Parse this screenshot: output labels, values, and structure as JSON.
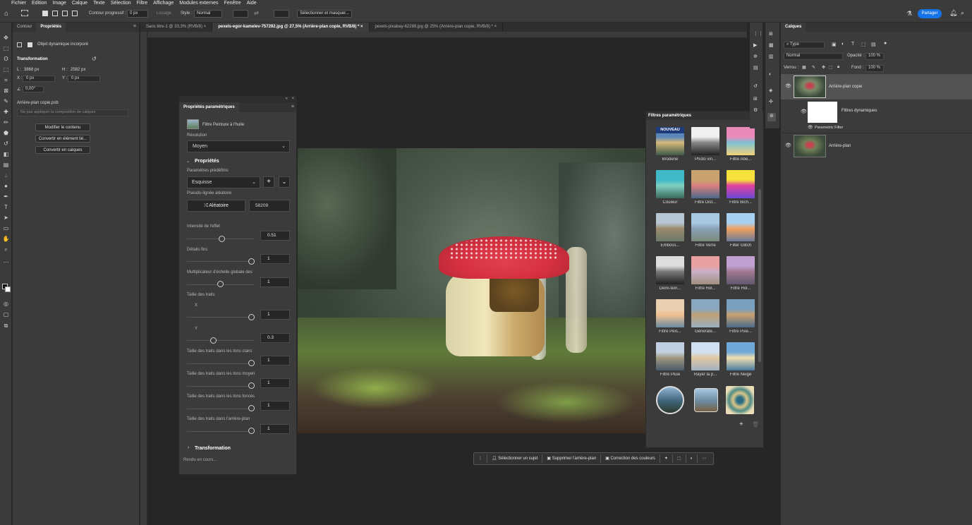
{
  "menu": [
    "Fichier",
    "Edition",
    "Image",
    "Calque",
    "Texte",
    "Sélection",
    "Filtre",
    "Affichage",
    "Modules externes",
    "Fenêtre",
    "Aide"
  ],
  "options": {
    "contour_label": "Contour progressif :",
    "contour_value": "0 px",
    "lissage_label": "Lissage",
    "style_label": "Style :",
    "style_value": "Normal",
    "select_mask_button": "Sélectionner et masquer...",
    "share_button": "Partager"
  },
  "left_panel": {
    "tabs": [
      "Contour",
      "Propriétés"
    ],
    "object_label": "Objet dynamique incorporé",
    "transformation_title": "Transformation",
    "w_label": "L :",
    "w_value": "3868 px",
    "h_label": "H :",
    "h_value": "2582 px",
    "x_label": "X :",
    "x_value": "0 px",
    "y_label": "Y :",
    "y_value": "0 px",
    "angle_value": "0,00°",
    "file_name": "Arrière-plan copie.psb",
    "comp_placeholder": "Ne pas appliquer la composition de calques",
    "buttons": [
      "Modifier le contenu",
      "Convertir en élément lié...",
      "Convertir en calques"
    ]
  },
  "doc_tabs": [
    {
      "label": "Sans titre-1 @ 33,3% (RVB/8)"
    },
    {
      "label": "pexels-egor-kamelev-757292.jpg @ 27,5% (Arrière-plan copie, RVB/8) *"
    },
    {
      "label": "pexels-pixabay-62289.jpg @ 25% (Arrière-plan copie, RVB/8) *"
    }
  ],
  "param_panel": {
    "title": "Propriétés paramétriques",
    "filter_name": "Filtre Peinture à l'huile",
    "resolution_label": "Résolution",
    "resolution_value": "Moyen",
    "props_title": "Propriétés",
    "preset_label": "Paramètres prédéfinis",
    "preset_value": "Esquisse",
    "seed_label": "Pseudo-lignée aléatoire",
    "random_button": "Aléatoire",
    "seed_value": "58209",
    "sliders": [
      {
        "label": "Intensité de l'effet",
        "value": "0.51"
      },
      {
        "label": "Détails fins",
        "value": "1"
      },
      {
        "label": "Multiplicateur d'échelle globale des",
        "value": "1"
      },
      {
        "label": "Taille des traits",
        "sub": "X",
        "value": "1"
      },
      {
        "label": "",
        "sub": "Y",
        "value": "0.3"
      },
      {
        "label": "Taille des traits dans les tons clairs",
        "value": "1"
      },
      {
        "label": "Taille des traits dans les tons moyen",
        "value": "1"
      },
      {
        "label": "Taille des traits dans les tons foncés",
        "value": "1"
      },
      {
        "label": "Taille des traits dans l'arrière-plan",
        "value": "1"
      }
    ],
    "transformation_label": "Transformation",
    "status": "Rendu en cours..."
  },
  "filters_panel": {
    "title": "Filtres paramétriques",
    "new_badge": "NOUVEAU",
    "items": [
      {
        "name": "Broderie"
      },
      {
        "name": "Photo vin..."
      },
      {
        "name": "Filtre Abe..."
      },
      {
        "name": "Couleur"
      },
      {
        "name": "Filtre Dist..."
      },
      {
        "name": "Filtre Bich..."
      },
      {
        "name": "Emboss..."
      },
      {
        "name": "Filtre Verre"
      },
      {
        "name": "Filter Glitch"
      },
      {
        "name": "Demi-tein..."
      },
      {
        "name": "Filtre Hol..."
      },
      {
        "name": "Filtre Hol..."
      },
      {
        "name": "Filtre Peis..."
      },
      {
        "name": "Générate..."
      },
      {
        "name": "Filtre Pixe..."
      },
      {
        "name": "Filtre Pluie"
      },
      {
        "name": "Rayer la p..."
      },
      {
        "name": "Filtre Neige"
      }
    ]
  },
  "layers_panel": {
    "title": "Calques",
    "kind_value": "Type",
    "blend_value": "Normal",
    "opacity_label": "Opacité :",
    "opacity_value": "100 %",
    "lock_label": "Verrou :",
    "fill_label": "Fond :",
    "fill_value": "100 %",
    "layers": [
      {
        "name": "Arrière-plan copie"
      },
      {
        "name": "Filtres dynamiques"
      },
      {
        "name": "Parametric Filter"
      },
      {
        "name": "Arrière-plan"
      }
    ]
  },
  "context_bar": {
    "items": [
      "Sélectionner un sujet",
      "Supprimer l'arrière-plan",
      "Correction des couleurs"
    ]
  },
  "colors": {
    "accent": "#1473e6",
    "mushroom_red": "#d63040"
  }
}
